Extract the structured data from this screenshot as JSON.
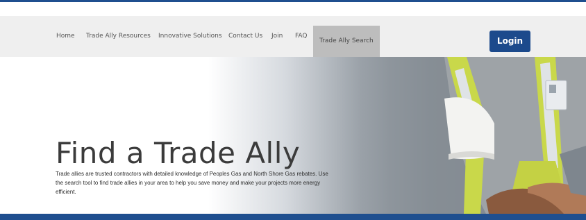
{
  "nav": {
    "items": [
      {
        "label": "Home"
      },
      {
        "label": "Trade Ally Resources"
      },
      {
        "label": "Innovative Solutions"
      },
      {
        "label": "Contact Us"
      },
      {
        "label": "Join"
      },
      {
        "label": "FAQ"
      },
      {
        "label": "Trade Ally Search"
      }
    ],
    "active": "Trade Ally Search",
    "login_label": "Login"
  },
  "hero": {
    "title": "Find a Trade Ally",
    "description": "Trade allies are trusted contractors with detailed knowledge of Peoples Gas and North Shore Gas rebates. Use the search tool to find trade allies in your area to help you save money and make your projects more energy efficient."
  },
  "colors": {
    "brand_blue": "#1c4a8c",
    "nav_bg": "#efefef",
    "active_nav_bg": "#bdbdbd"
  }
}
